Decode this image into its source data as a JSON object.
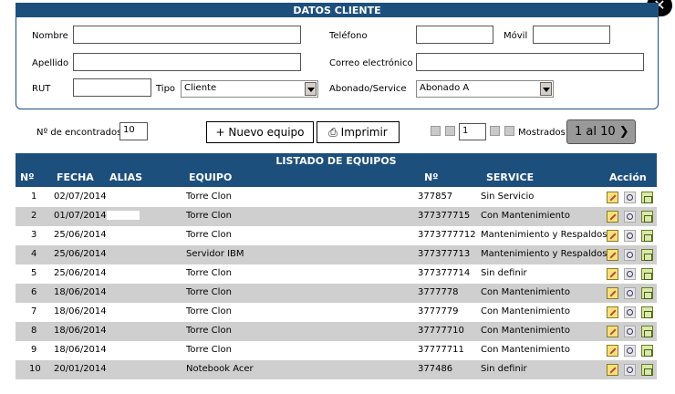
{
  "close_glyph": "✕",
  "client": {
    "title": "DATOS CLIENTE",
    "nombre_label": "Nombre",
    "nombre_value": "",
    "apellido_label": "Apellido",
    "apellido_value": "",
    "rut_label": "RUT",
    "rut_value": "",
    "tipo_label": "Tipo",
    "tipo_value": "Cliente",
    "telefono_label": "Teléfono",
    "telefono_value": "",
    "movil_label": "Móvil",
    "movil_value": "",
    "correo_label": "Correo electrónico",
    "correo_value": "",
    "abonado_label": "Abonado/Service",
    "abonado_value": "Abonado A"
  },
  "toolbar": {
    "encontrados_label": "Nº de encontrados",
    "encontrados_value": "10",
    "nuevo_label": "+ Nuevo equipo",
    "imprimir_label": "⎙ Imprimir",
    "page_value": "1",
    "mostrados_label": "Mostrados",
    "mostrados_value": "1 al 10 ❯"
  },
  "table": {
    "title": "LISTADO DE EQUIPOS",
    "headers": {
      "num": "Nº",
      "fecha": "FECHA",
      "alias": "ALIAS",
      "equipo": "EQUIPO",
      "serie": "Nº",
      "service": "SERVICE",
      "accion": "Acción"
    },
    "rows": [
      {
        "num": "1",
        "fecha": "02/07/2014",
        "equipo": "Torre Clon",
        "serie": "377857",
        "service": "Sin Servicio"
      },
      {
        "num": "2",
        "fecha": "01/07/2014",
        "equipo": "Torre Clon",
        "serie": "377377715",
        "service": "Con Mantenimiento"
      },
      {
        "num": "3",
        "fecha": "25/06/2014",
        "equipo": "Torre Clon",
        "serie": "3773777712",
        "service": "Mantenimiento y Respaldos"
      },
      {
        "num": "4",
        "fecha": "25/06/2014",
        "equipo": "Servidor IBM",
        "serie": "377377713",
        "service": "Mantenimiento y Respaldos"
      },
      {
        "num": "5",
        "fecha": "25/06/2014",
        "equipo": "Torre Clon",
        "serie": "377377714",
        "service": "Sin definir"
      },
      {
        "num": "6",
        "fecha": "18/06/2014",
        "equipo": "Torre Clon",
        "serie": "3777778",
        "service": "Con Mantenimiento"
      },
      {
        "num": "7",
        "fecha": "18/06/2014",
        "equipo": "Torre Clon",
        "serie": "3777779",
        "service": "Con Mantenimiento"
      },
      {
        "num": "8",
        "fecha": "18/06/2014",
        "equipo": "Torre Clon",
        "serie": "37777710",
        "service": "Con Mantenimiento"
      },
      {
        "num": "9",
        "fecha": "18/06/2014",
        "equipo": "Torre Clon",
        "serie": "37777711",
        "service": "Con Mantenimiento"
      },
      {
        "num": "10",
        "fecha": "20/01/2014",
        "equipo": "Notebook Acer",
        "serie": "377486",
        "service": "Sin definir"
      }
    ]
  },
  "colors": {
    "header": "#1d4f7d",
    "row_alt": "#cfcfcf"
  }
}
